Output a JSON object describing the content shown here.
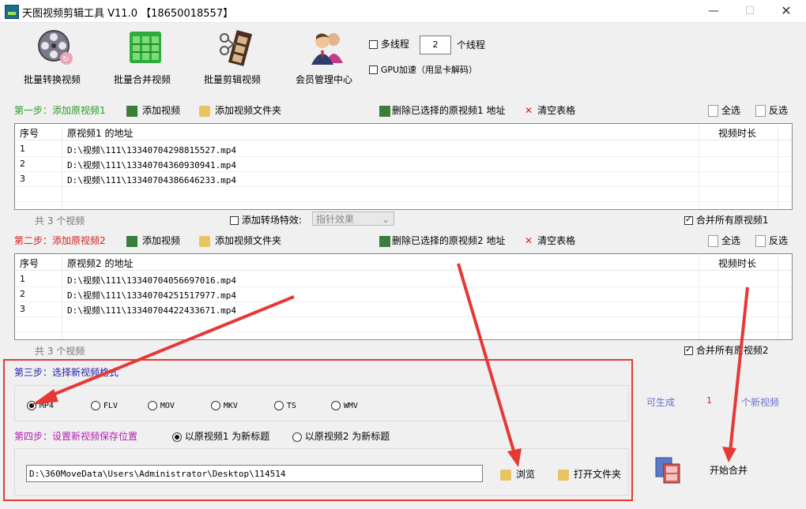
{
  "window": {
    "title": "天图视频剪辑工具 V11.0 【18650018557】",
    "minimize": "—",
    "maximize": "☐",
    "close": "✕"
  },
  "toolbar": {
    "items": [
      {
        "label": "批量转换视频",
        "icon": "film-reel-icon"
      },
      {
        "label": "批量合并视频",
        "icon": "merge-grid-icon"
      },
      {
        "label": "批量剪辑视频",
        "icon": "film-scissors-icon"
      },
      {
        "label": "会员管理中心",
        "icon": "members-icon"
      }
    ],
    "multithread_label": "多线程",
    "thread_count": "2",
    "thread_unit": "个线程",
    "gpu_label": "GPU加速（用显卡解码）"
  },
  "step1": {
    "title": "第一步：添加原视频1",
    "add_video": "添加视频",
    "add_folder": "添加视频文件夹",
    "delete_selected": "删除已选择的原视频1 地址",
    "clear_table": "清空表格",
    "select_all": "全选",
    "invert": "反选",
    "columns": [
      "序号",
      "原视频1 的地址",
      "视频时长"
    ],
    "rows": [
      {
        "no": "1",
        "path": "D:\\视频\\111\\13340704298815527.mp4",
        "duration": ""
      },
      {
        "no": "2",
        "path": "D:\\视频\\111\\13340704360930941.mp4",
        "duration": ""
      },
      {
        "no": "3",
        "path": "D:\\视频\\111\\13340704386646233.mp4",
        "duration": ""
      }
    ],
    "count_text": "共 3 个视频",
    "transition_label": "添加转场特效:",
    "transition_value": "指针效果",
    "merge_all_label": "合并所有原视频1"
  },
  "step2": {
    "title": "第二步：添加原视频2",
    "add_video": "添加视频",
    "add_folder": "添加视频文件夹",
    "delete_selected": "删除已选择的原视频2 地址",
    "clear_table": "清空表格",
    "select_all": "全选",
    "invert": "反选",
    "columns": [
      "序号",
      "原视频2 的地址",
      "视频时长"
    ],
    "rows": [
      {
        "no": "1",
        "path": "D:\\视频\\111\\13340704056697016.mp4",
        "duration": ""
      },
      {
        "no": "2",
        "path": "D:\\视频\\111\\13340704251517977.mp4",
        "duration": ""
      },
      {
        "no": "3",
        "path": "D:\\视频\\111\\13340704422433671.mp4",
        "duration": ""
      }
    ],
    "count_text": "共 3 个视频",
    "merge_all_label": "合并所有原视频2"
  },
  "step3": {
    "title": "第三步：选择新视频格式",
    "formats": [
      "MP4",
      "FLV",
      "MOV",
      "MKV",
      "TS",
      "WMV"
    ],
    "selected": "MP4"
  },
  "generate": {
    "prefix": "可生成",
    "count": "1",
    "suffix": "个新视频"
  },
  "step4": {
    "title": "第四步：设置新视频保存位置",
    "option1": "以原视频1 为新标题",
    "option2": "以原视频2 为新标题",
    "selected_option": "option1",
    "save_path": "D:\\360MoveData\\Users\\Administrator\\Desktop\\114514",
    "browse": "浏览",
    "open_folder": "打开文件夹"
  },
  "start_merge": "开始合并",
  "colors": {
    "red_annotation": "#e53935",
    "step1": "#2a9a2a",
    "step2": "#d82020",
    "step3": "#2222aa",
    "step4": "#b01fb0",
    "generate": "#6f6fd0"
  }
}
